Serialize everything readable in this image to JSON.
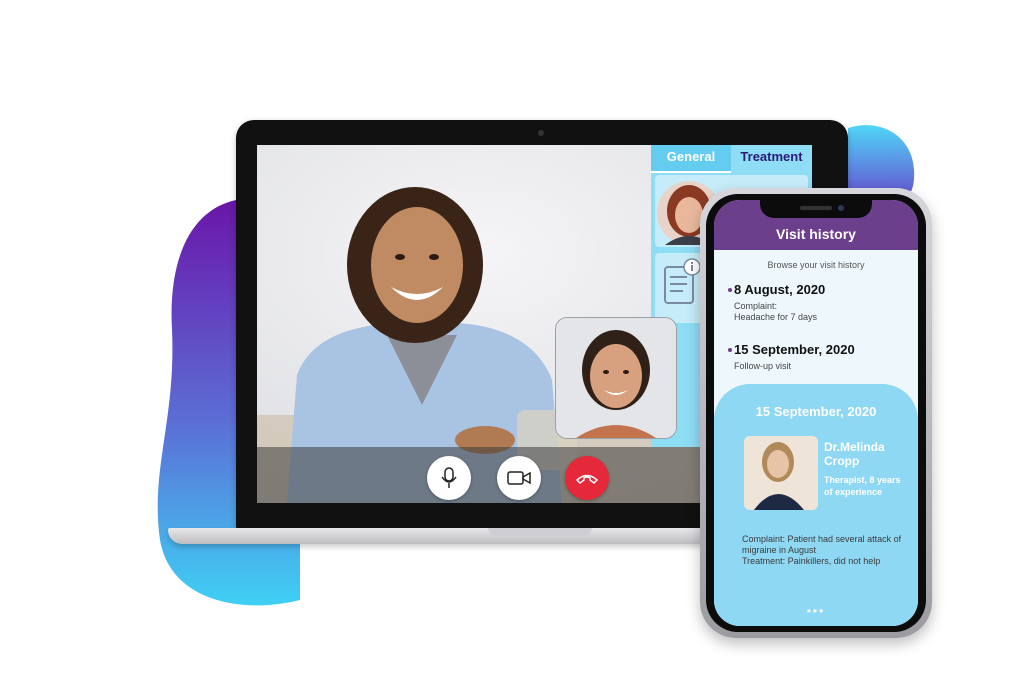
{
  "colors": {
    "brand_purple": "#6c3f8c",
    "accent_blue": "#64ccef",
    "panel_blue": "#8fdcf5",
    "end_call_red": "#e5283a"
  },
  "side_panel": {
    "tabs": [
      {
        "label": "General",
        "active": true
      },
      {
        "label": "Treatment",
        "active": false
      }
    ]
  },
  "call_controls": [
    {
      "name": "microphone",
      "icon": "microphone-icon"
    },
    {
      "name": "camera",
      "icon": "video-camera-icon"
    },
    {
      "name": "end-call",
      "icon": "phone-hangup-icon"
    }
  ],
  "phone": {
    "title": "Visit history",
    "subtitle": "Browse your visit history",
    "visits": [
      {
        "date": "8 August, 2020",
        "line1": "Complaint:",
        "line2": "Headache for 7 days"
      },
      {
        "date": "15 September, 2020",
        "line1": "Follow-up visit",
        "line2": ""
      }
    ],
    "detail": {
      "date": "15 September, 2020",
      "doctor_name": "Dr.Melinda Cropp",
      "doctor_role": "Therapist, 8 years of experience",
      "complaint": "Complaint: Patient had several attack of migraine in August",
      "treatment": "Treatment: Painkillers, did not help",
      "pager": "•••"
    }
  }
}
